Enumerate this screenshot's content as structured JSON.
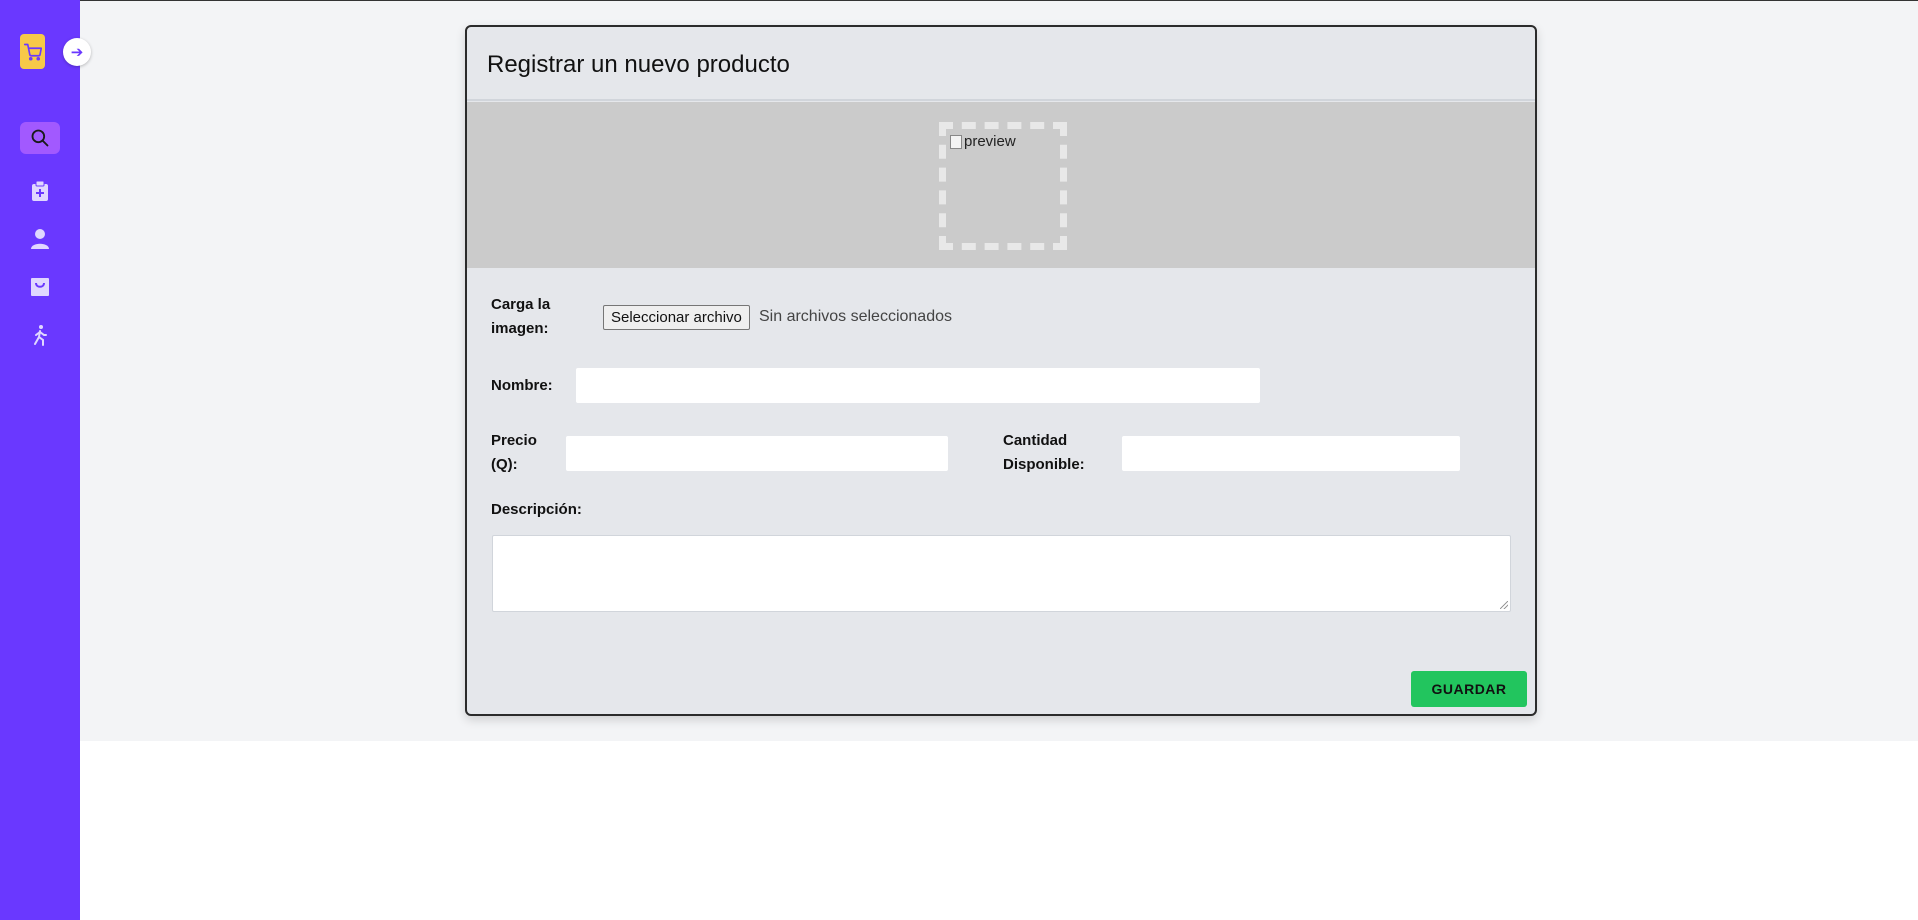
{
  "sidebar": {
    "logo_icon": "shopping-cart-icon",
    "toggle_icon": "arrow-right-icon",
    "items": [
      {
        "icon": "search-icon",
        "active": true
      },
      {
        "icon": "medical-clipboard-icon",
        "active": false
      },
      {
        "icon": "user-icon",
        "active": false
      },
      {
        "icon": "shopping-bag-icon",
        "active": false
      },
      {
        "icon": "walking-person-icon",
        "active": false
      }
    ],
    "colors": {
      "background": "#6a38ff",
      "active": "#a259ff",
      "logo": "#f7c948"
    }
  },
  "card": {
    "title": "Registrar un nuevo producto",
    "preview_alt": "preview",
    "image_label": "Carga la imagen:",
    "file_button": "Seleccionar archivo",
    "file_status": "Sin archivos seleccionados",
    "name_label": "Nombre:",
    "name_value": "",
    "price_label": "Precio (Q):",
    "price_value": "",
    "quantity_label": "Cantidad Disponible:",
    "quantity_value": "",
    "description_label": "Descripción:",
    "description_value": "",
    "save_button": "GUARDAR",
    "colors": {
      "save": "#22c55e",
      "card": "#e5e7eb",
      "preview": "#cbcbcb"
    }
  }
}
